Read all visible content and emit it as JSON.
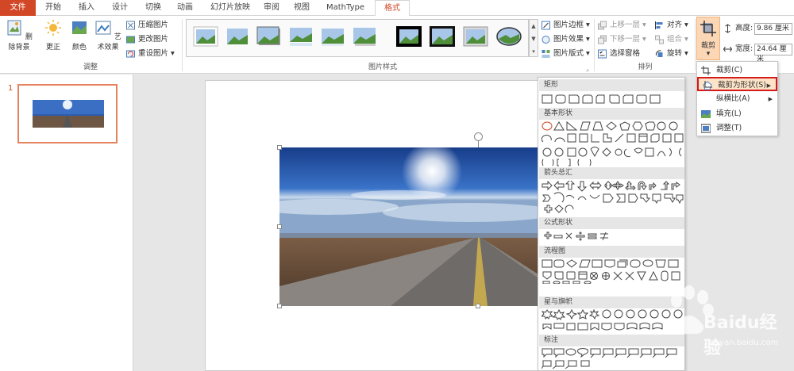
{
  "tabs": [
    {
      "label": "文件"
    },
    {
      "label": "开始"
    },
    {
      "label": "插入"
    },
    {
      "label": "设计"
    },
    {
      "label": "切换"
    },
    {
      "label": "动画"
    },
    {
      "label": "幻灯片放映"
    },
    {
      "label": "审阅"
    },
    {
      "label": "视图"
    },
    {
      "label": "MathType"
    },
    {
      "label": "格式"
    }
  ],
  "ribbon": {
    "adjust": {
      "remove_bg": "删除背景",
      "corrections": "更正",
      "color": "颜色",
      "artistic": "艺术效果",
      "compress": "压缩图片",
      "change": "更改图片",
      "reset": "重设图片",
      "label": "调整"
    },
    "styles": {
      "label": "图片样式",
      "border": "图片边框",
      "effects": "图片效果",
      "layout": "图片版式"
    },
    "arrange": {
      "label": "排列",
      "forward": "上移一层",
      "backward": "下移一层",
      "selection_pane": "选择窗格",
      "align": "对齐",
      "group": "组合",
      "rotate": "旋转"
    },
    "size": {
      "crop": "裁剪",
      "height_label": "高度:",
      "height_value": "9.86 厘米",
      "width_label": "宽度:",
      "width_value": "24.64 厘米"
    }
  },
  "slides_pane": {
    "slide_number": "1"
  },
  "crop_menu": {
    "items": [
      {
        "label": "裁剪(C)"
      },
      {
        "label": "裁剪为形状(S)"
      },
      {
        "label": "纵横比(A)"
      },
      {
        "label": "填充(L)"
      },
      {
        "label": "调整(T)"
      }
    ]
  },
  "shapes_menu": {
    "categories": [
      {
        "label": "矩形"
      },
      {
        "label": "基本形状"
      },
      {
        "label": "箭头总汇"
      },
      {
        "label": "公式形状"
      },
      {
        "label": "流程图"
      },
      {
        "label": "星与旗帜"
      },
      {
        "label": "标注"
      }
    ]
  },
  "watermark": {
    "text": "Baidu经验",
    "url": "jingyan.baidu.com"
  },
  "colors": {
    "accent": "#d24726",
    "highlight": "#fde4c8",
    "red_box": "#d61a1a",
    "sky": "#1f4d9c"
  }
}
